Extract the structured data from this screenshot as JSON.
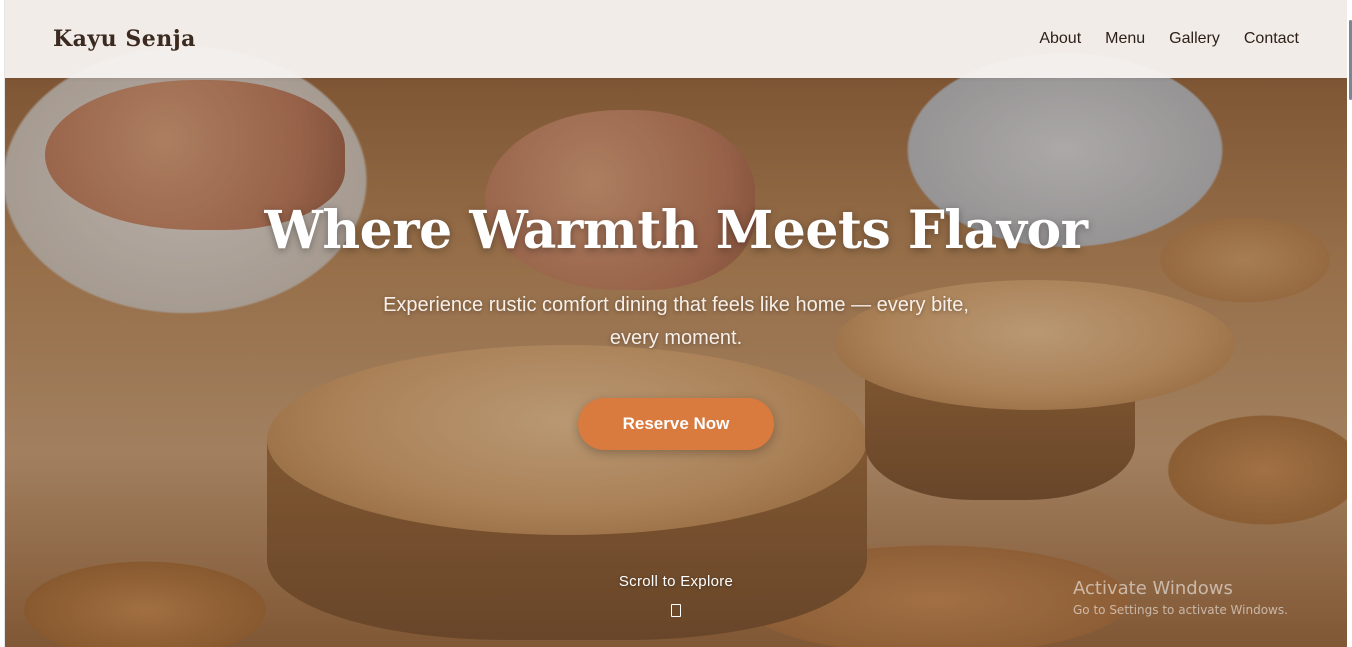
{
  "brand": {
    "name": "Kayu Senja"
  },
  "nav": {
    "items": [
      {
        "label": "About"
      },
      {
        "label": "Menu"
      },
      {
        "label": "Gallery"
      },
      {
        "label": "Contact"
      }
    ]
  },
  "hero": {
    "title": "Where Warmth Meets Flavor",
    "subtitle": "Experience rustic comfort dining that feels like home — every bite, every moment.",
    "cta_label": "Reserve Now",
    "scroll_label": "Scroll to Explore",
    "scroll_icon": "scroll-indicator-icon"
  },
  "os_watermark": {
    "title": "Activate Windows",
    "subtitle": "Go to Settings to activate Windows."
  },
  "colors": {
    "accent": "#d97a3f",
    "navbar_bg": "#f6f2ee",
    "brand_text": "#3b2a1f"
  }
}
